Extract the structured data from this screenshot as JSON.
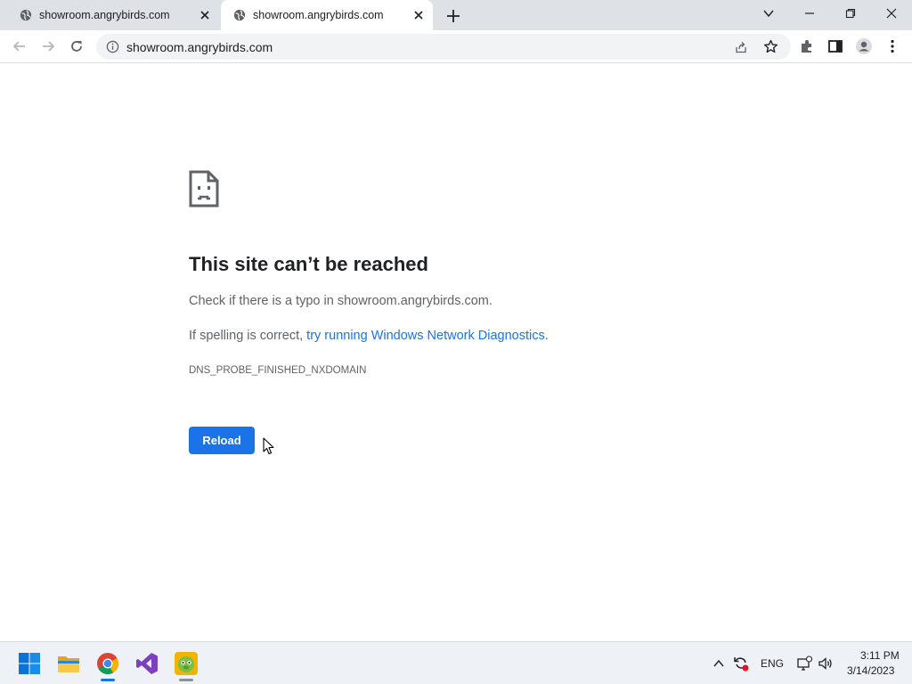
{
  "tabs": [
    {
      "title": "showroom.angrybirds.com",
      "active": false
    },
    {
      "title": "showroom.angrybirds.com",
      "active": true
    }
  ],
  "toolbar": {
    "url": "showroom.angrybirds.com"
  },
  "error": {
    "heading": "This site can’t be reached",
    "line1": "Check if there is a typo in showroom.angrybirds.com.",
    "line2_prefix": "If spelling is correct, ",
    "line2_link": "try running Windows Network Diagnostics",
    "line2_suffix": ".",
    "code": "DNS_PROBE_FINISHED_NXDOMAIN",
    "reload_label": "Reload"
  },
  "taskbar": {
    "language": "ENG",
    "time": "3:11 PM",
    "date": "3/14/2023"
  },
  "colors": {
    "accent": "#1a73e8",
    "text_secondary": "#5f6368"
  }
}
